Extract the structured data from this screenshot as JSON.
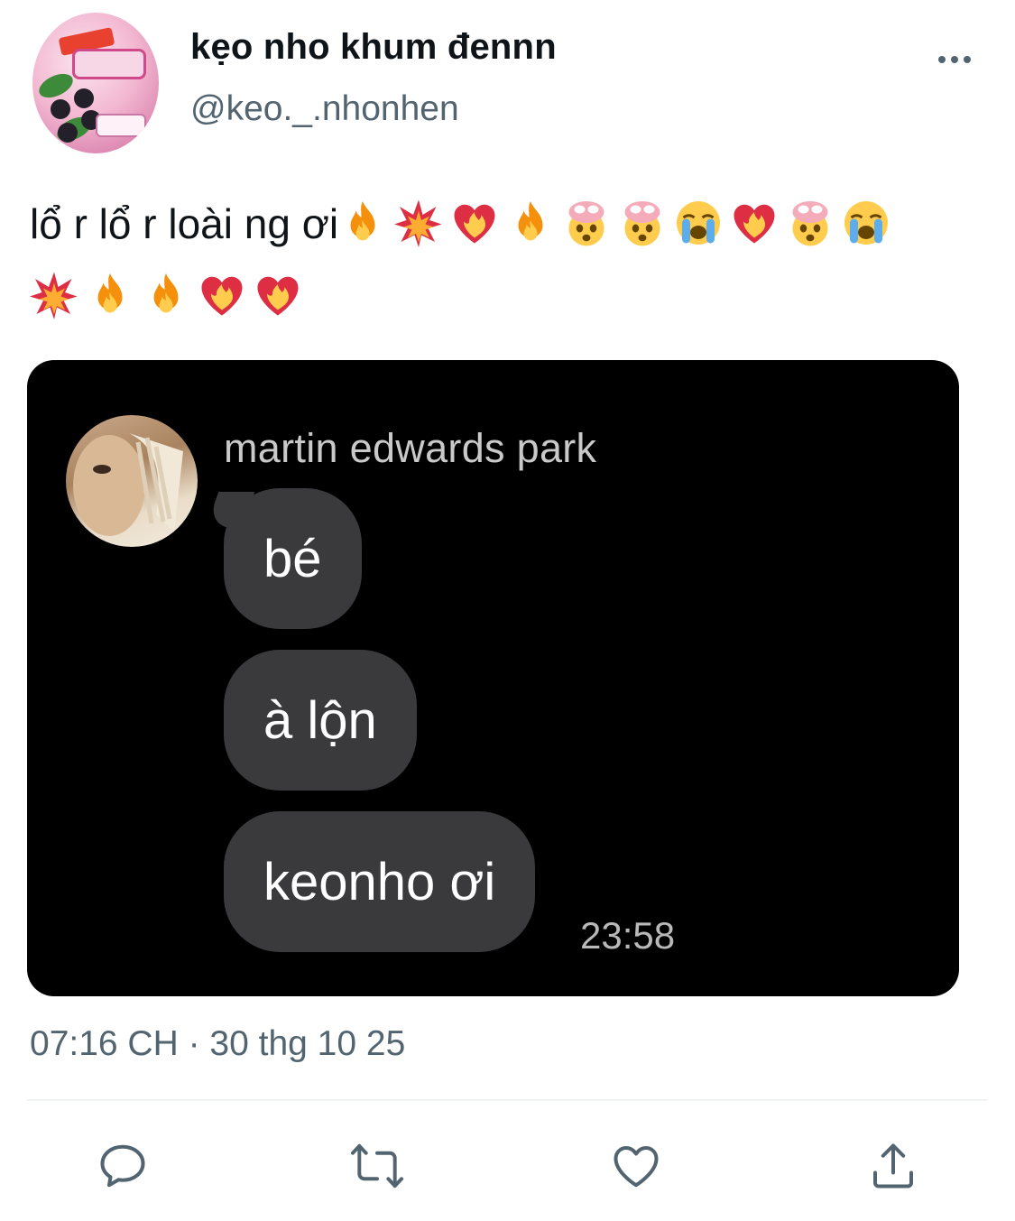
{
  "header": {
    "display_name": "kẹo nho khum đennn",
    "handle": "@keo._.nhonhen",
    "more_icon": "more-horizontal-icon"
  },
  "tweet": {
    "text": "lổ r lổ r loài ng ơi",
    "emojis_line1": [
      "fire",
      "collision",
      "heart-on-fire",
      "fire",
      "exploding-head",
      "exploding-head",
      "loudly-crying-face",
      "heart-on-fire",
      "exploding-head",
      "loudly-crying-face"
    ],
    "emojis_line2": [
      "collision",
      "fire",
      "fire",
      "heart-on-fire",
      "heart-on-fire"
    ]
  },
  "media": {
    "sender_name": "martin edwards park",
    "messages": [
      "bé",
      "à lộn",
      "keonho ơi"
    ],
    "time": "23:58"
  },
  "footer": {
    "timestamp": "07:16 CH · 30 thg 10 25"
  },
  "actions": {
    "reply_icon": "reply-icon",
    "retweet_icon": "retweet-icon",
    "like_icon": "heart-icon",
    "share_icon": "share-icon"
  },
  "colors": {
    "text_primary": "#0f1419",
    "text_secondary": "#536471",
    "bubble": "#3a3a3c",
    "media_bg": "#000000"
  }
}
